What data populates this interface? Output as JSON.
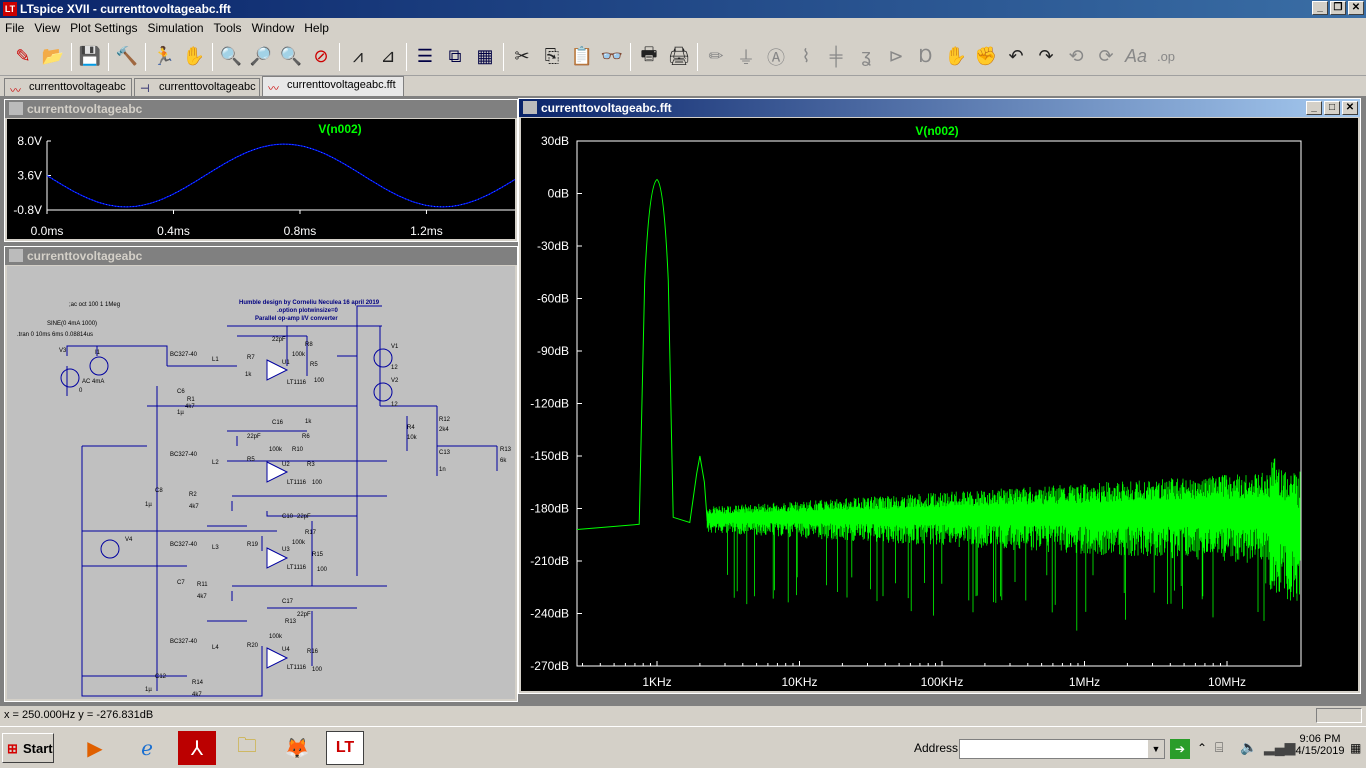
{
  "app": {
    "title": "LTspice XVII - currenttovoltageabc.fft",
    "icon": "ltspice-icon"
  },
  "menu": [
    "File",
    "View",
    "Plot Settings",
    "Simulation",
    "Tools",
    "Window",
    "Help"
  ],
  "tabs": [
    {
      "label": "currenttovoltageabc",
      "icon": "waveform-icon"
    },
    {
      "label": "currenttovoltageabc",
      "icon": "schematic-icon"
    },
    {
      "label": "currenttovoltageabc.fft",
      "icon": "waveform-icon"
    }
  ],
  "transient_window": {
    "title": "currenttovoltageabc",
    "trace": "V(n002)",
    "chart_data": {
      "type": "line",
      "y_ticks": [
        "8.0V",
        "3.6V",
        "-0.8V"
      ],
      "x_ticks": [
        "0.0ms",
        "0.4ms",
        "0.8ms",
        "1.2ms"
      ],
      "xlim": [
        0,
        1.48
      ],
      "ylim": [
        -0.8,
        8.0
      ],
      "series": [
        {
          "name": "V(n002)",
          "color": "#0000ff",
          "function": "sine",
          "offset": 3.6,
          "amplitude": 4.0,
          "frequency_khz": 1.0
        }
      ]
    }
  },
  "schematic_window": {
    "title": "currenttovoltageabc",
    "texts": {
      "ac": ";ac oct 100 1 1Meg",
      "sine": "SINE(0 4mA 1000)",
      "tran": ".tran 0 10ms 6ms 0.08814us",
      "credit": "Humble design by Corneliu Neculea 16 april 2019",
      "option": ".option plotwinsize=0",
      "parallel": "Parallel op-amp I/V converter"
    }
  },
  "fft_window": {
    "title": "currenttovoltageabc.fft",
    "trace": "V(n002)",
    "chart_data": {
      "type": "line",
      "y_ticks": [
        "30dB",
        "0dB",
        "-30dB",
        "-60dB",
        "-90dB",
        "-120dB",
        "-150dB",
        "-180dB",
        "-210dB",
        "-240dB",
        "-270dB"
      ],
      "x_ticks": [
        "1KHz",
        "10KHz",
        "100KHz",
        "1MHz",
        "10MHz"
      ],
      "ylim": [
        -270,
        30
      ],
      "x_scale": "log",
      "series": [
        {
          "name": "V(n002)",
          "color": "#00ff00",
          "peaks": [
            {
              "x_hz": 1000,
              "y_db": 8
            },
            {
              "x_hz": 2000,
              "y_db": -150
            }
          ]
        }
      ]
    }
  },
  "statusbar": {
    "readout": "x = 250.000Hz    y = -276.831dB"
  },
  "taskbar": {
    "start": "Start",
    "address_label": "Address",
    "time": "9:06 PM",
    "date": "4/15/2019"
  }
}
